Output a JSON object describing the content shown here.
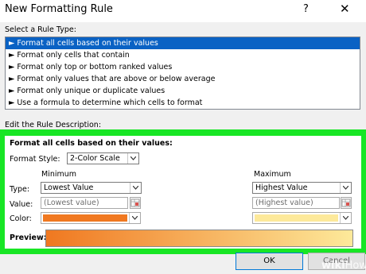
{
  "window": {
    "title": "New Formatting Rule",
    "help_symbol": "?",
    "close_symbol": "✕"
  },
  "rule_type": {
    "label": "Select a Rule Type:",
    "items": [
      {
        "label": "► Format all cells based on their values",
        "selected": true
      },
      {
        "label": "► Format only cells that contain",
        "selected": false
      },
      {
        "label": "► Format only top or bottom ranked values",
        "selected": false
      },
      {
        "label": "► Format only values that are above or below average",
        "selected": false
      },
      {
        "label": "► Format only unique or duplicate values",
        "selected": false
      },
      {
        "label": "► Use a formula to determine which cells to format",
        "selected": false
      }
    ]
  },
  "description": {
    "label": "Edit the Rule Description:",
    "heading": "Format all cells based on their values:",
    "format_style_label": "Format Style:",
    "format_style_value": "2-Color Scale",
    "row_labels": {
      "type": "Type:",
      "value": "Value:",
      "color": "Color:"
    },
    "minimum": {
      "header": "Minimum",
      "type": "Lowest Value",
      "value_placeholder": "(Lowest value)",
      "color": "#f07820"
    },
    "maximum": {
      "header": "Maximum",
      "type": "Highest Value",
      "value_placeholder": "(Highest value)",
      "color": "#fde99a"
    },
    "preview_label": "Preview:"
  },
  "buttons": {
    "ok": "OK",
    "cancel": "Cancel"
  },
  "watermark": {
    "bold": "wiki",
    "light": "How"
  },
  "colors": {
    "highlight": "#0a62c4",
    "frame": "#18e625"
  }
}
